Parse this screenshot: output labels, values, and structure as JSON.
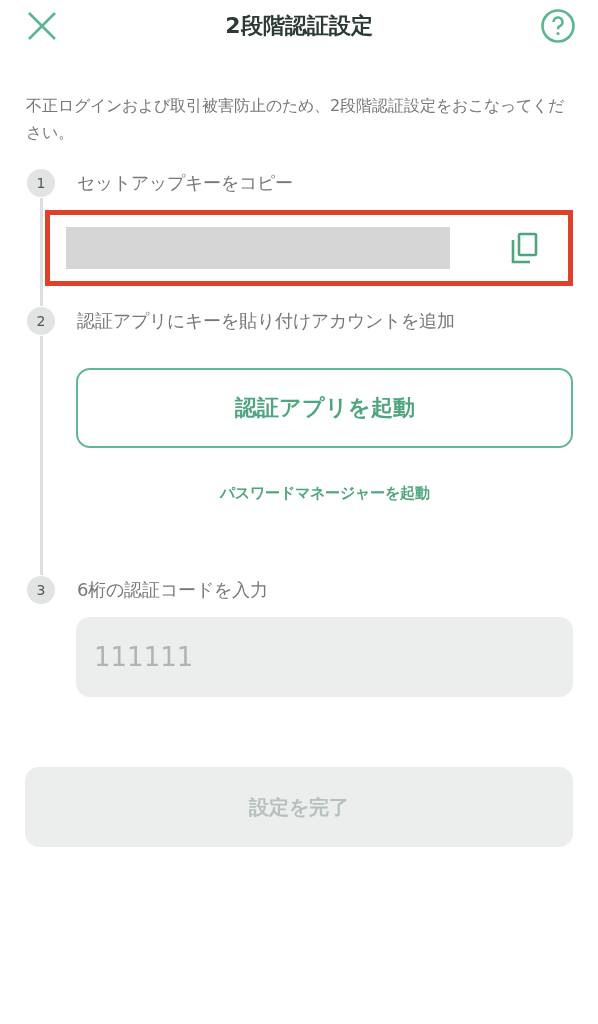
{
  "header": {
    "title": "2段階認証設定"
  },
  "description": "不正ログインおよび取引被害防止のため、2段階認証設定をおこなってください。",
  "steps": [
    {
      "kind": "copy",
      "number": "1",
      "label": "セットアップキーをコピー",
      "highlighted": true
    },
    {
      "kind": "launch",
      "number": "2",
      "label": "認証アプリにキーを貼り付けアカウントを追加",
      "button": "認証アプリを起動",
      "link": "パスワードマネージャーを起動"
    },
    {
      "kind": "input",
      "number": "3",
      "label": "6桁の認証コードを入力",
      "placeholder": "111111"
    }
  ],
  "submit": {
    "label": "設定を完了",
    "disabled": true
  }
}
